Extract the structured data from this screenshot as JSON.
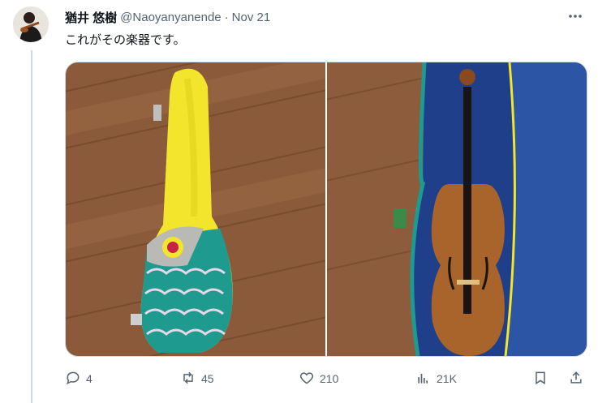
{
  "tweet": {
    "display_name": "猶井 悠樹",
    "handle": "@Naoyanyanende",
    "separator": "·",
    "date": "Nov 21",
    "text": "これがその楽器です。",
    "icons": {
      "more": "more-icon",
      "reply": "reply-icon",
      "retweet": "retweet-icon",
      "like": "like-icon",
      "views": "views-icon",
      "bookmark": "bookmark-icon",
      "share": "share-icon"
    },
    "stats": {
      "replies": "4",
      "retweets": "45",
      "likes": "210",
      "views": "21K"
    }
  },
  "colors": {
    "text": "#0f1419",
    "secondary": "#536471",
    "case_yellow": "#f2e52c",
    "case_teal": "#1e9a8f",
    "case_interior_blue": "#2c55a5"
  }
}
